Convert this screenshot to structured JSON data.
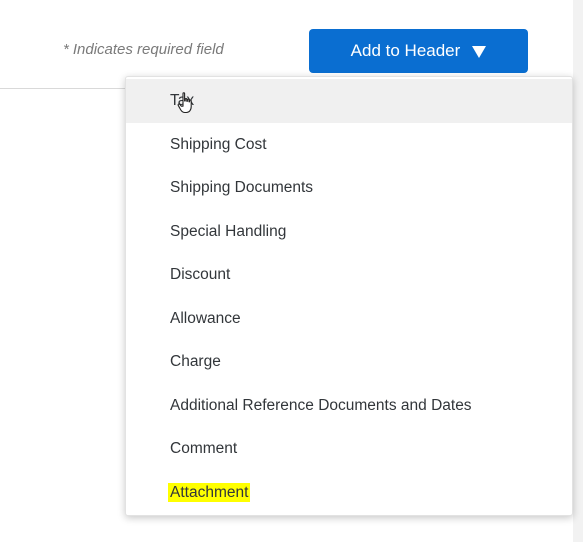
{
  "header": {
    "required_asterisk": "*",
    "required_note": "Indicates required field",
    "add_button_label": "Add to Header"
  },
  "menu": {
    "items": [
      {
        "label": "Tax"
      },
      {
        "label": "Shipping Cost"
      },
      {
        "label": "Shipping Documents"
      },
      {
        "label": "Special Handling"
      },
      {
        "label": "Discount"
      },
      {
        "label": "Allowance"
      },
      {
        "label": "Charge"
      },
      {
        "label": "Additional Reference Documents and Dates"
      },
      {
        "label": "Comment"
      },
      {
        "label": "Attachment"
      }
    ],
    "hovered_item": "Tax",
    "highlighted_item": "Attachment"
  },
  "colors": {
    "button": "#0a6ed1",
    "highlight": "#ffff00",
    "hover": "#f0f0f0"
  },
  "icons": {
    "cursor": "hand-pointer-icon",
    "dropdown": "caret-down-icon"
  }
}
